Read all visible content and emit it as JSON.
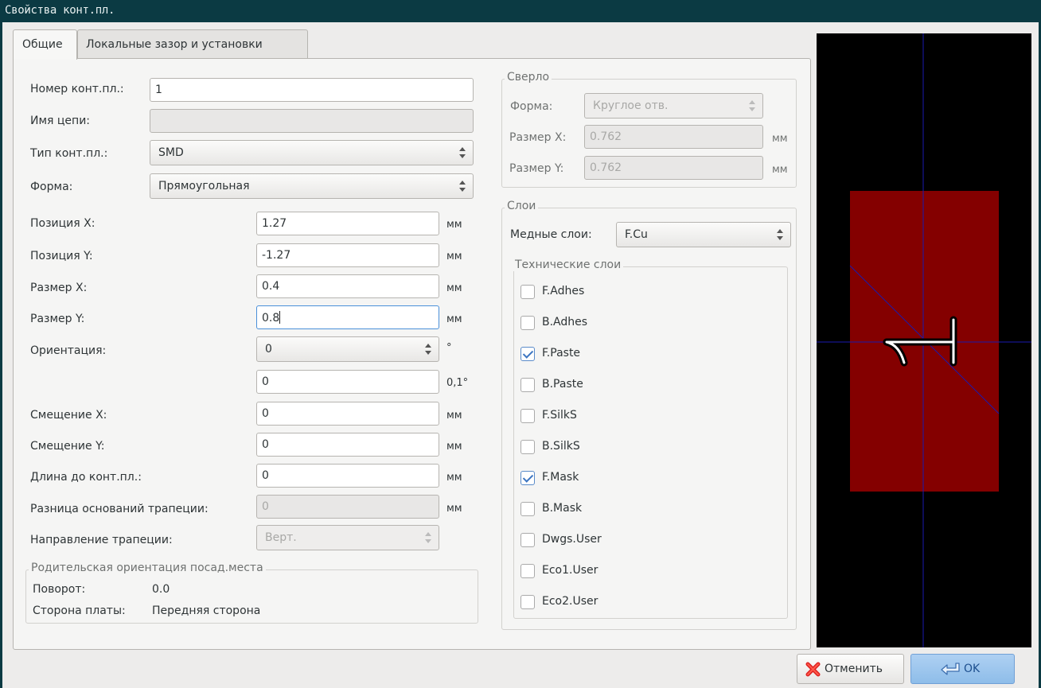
{
  "window": {
    "title": "Свойства конт.пл."
  },
  "tabs": [
    {
      "label": "Общие",
      "active": true
    },
    {
      "label": "Локальные зазор и установки",
      "active": false
    }
  ],
  "pad": {
    "number_label": "Номер конт.пл.:",
    "number_value": "1",
    "net_label": "Имя цепи:",
    "net_value": "",
    "type_label": "Тип конт.пл.:",
    "type_value": "SMD",
    "shape_label": "Форма:",
    "shape_value": "Прямоугольная"
  },
  "geometry": {
    "pos_x": {
      "label": "Позиция X:",
      "value": "1.27",
      "unit": "мм"
    },
    "pos_y": {
      "label": "Позиция Y:",
      "value": "-1.27",
      "unit": "мм"
    },
    "size_x": {
      "label": "Размер X:",
      "value": "0.4",
      "unit": "мм"
    },
    "size_y": {
      "label": "Размер Y:",
      "value": "0.8",
      "unit": "мм"
    },
    "orientation": {
      "label": "Ориентация:",
      "value": "0",
      "unit": "°"
    },
    "orientation_custom": {
      "value": "0",
      "unit": "0,1°"
    },
    "offset_x": {
      "label": "Смещение X:",
      "value": "0",
      "unit": "мм"
    },
    "offset_y": {
      "label": "Смещение Y:",
      "value": "0",
      "unit": "мм"
    },
    "die_length": {
      "label": "Длина до конт.пл.:",
      "value": "0",
      "unit": "мм"
    },
    "trap_delta": {
      "label": "Разница оснований трапеции:",
      "value": "0",
      "unit": "мм"
    },
    "trap_dir": {
      "label": "Направление трапеции:",
      "value": "Верт."
    }
  },
  "parent": {
    "title": "Родительская ориентация посад.места",
    "rotation_label": "Поворот:",
    "rotation_value": "0.0",
    "side_label": "Сторона платы:",
    "side_value": "Передняя сторона"
  },
  "drill": {
    "title": "Сверло",
    "shape_label": "Форма:",
    "shape_value": "Круглое отв.",
    "size_x_label": "Размер X:",
    "size_x_value": "0.762",
    "size_y_label": "Размер Y:",
    "size_y_value": "0.762",
    "unit": "мм"
  },
  "layers": {
    "title": "Слои",
    "copper_label": "Медные слои:",
    "copper_value": "F.Cu",
    "tech_title": "Технические слои",
    "items": [
      {
        "label": "F.Adhes",
        "checked": false
      },
      {
        "label": "B.Adhes",
        "checked": false
      },
      {
        "label": "F.Paste",
        "checked": true
      },
      {
        "label": "B.Paste",
        "checked": false
      },
      {
        "label": "F.SilkS",
        "checked": false
      },
      {
        "label": "B.SilkS",
        "checked": false
      },
      {
        "label": "F.Mask",
        "checked": true
      },
      {
        "label": "B.Mask",
        "checked": false
      },
      {
        "label": "Dwgs.User",
        "checked": false
      },
      {
        "label": "Eco1.User",
        "checked": false
      },
      {
        "label": "Eco2.User",
        "checked": false
      }
    ]
  },
  "buttons": {
    "cancel": "Отменить",
    "ok": "OK"
  },
  "colors": {
    "titlebar": "#0b3a43",
    "pad": "#840000",
    "crosshair": "#1a1ab0",
    "preview_bg": "#000000"
  }
}
